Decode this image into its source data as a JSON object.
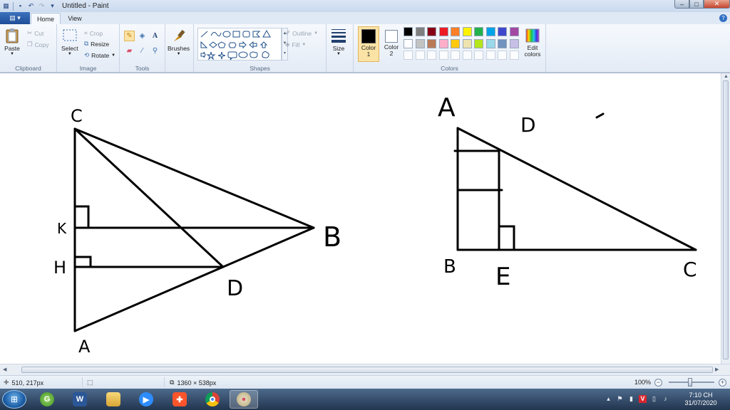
{
  "window": {
    "title": "Untitled - Paint",
    "minimize_glyph": "–",
    "maximize_glyph": "□",
    "close_glyph": "✕"
  },
  "tabs": {
    "home": "Home",
    "view": "View"
  },
  "help_glyph": "?",
  "clipboard": {
    "paste": "Paste",
    "cut": "Cut",
    "copy": "Copy",
    "label": "Clipboard"
  },
  "image_group": {
    "select": "Select",
    "crop": "Crop",
    "resize": "Resize",
    "rotate": "Rotate",
    "label": "Image"
  },
  "tools": {
    "label": "Tools"
  },
  "brushes": {
    "label": "Brushes"
  },
  "shapes": {
    "outline": "Outline",
    "fill": "Fill",
    "label": "Shapes"
  },
  "size": {
    "label": "Size"
  },
  "colors_group": {
    "color1": "Color 1",
    "color2": "Color 2",
    "edit_colors": "Edit colors",
    "label": "Colors",
    "color1_value": "#000000",
    "color2_value": "#ffffff",
    "palette": [
      "#000000",
      "#7f7f7f",
      "#880015",
      "#ed1c24",
      "#ff7f27",
      "#fff200",
      "#22b14c",
      "#00a2e8",
      "#3f48cc",
      "#a349a4",
      "#ffffff",
      "#c3c3c3",
      "#b97a57",
      "#ffaec9",
      "#ffc90e",
      "#efe4b0",
      "#b5e61d",
      "#99d9ea",
      "#7092be",
      "#c8bfe7"
    ]
  },
  "canvas": {
    "labels": {
      "left_C": "C",
      "left_K": "K",
      "left_H": "H",
      "left_B": "B",
      "left_D": "D",
      "left_A": "A",
      "right_A": "A",
      "right_D": "D",
      "right_B": "B",
      "right_E": "E",
      "right_C": "C"
    }
  },
  "status": {
    "cursor_position": "510, 217px",
    "image_size": "1360 × 538px",
    "zoom": "100%"
  },
  "taskbar": {
    "apps": [
      "start-orb",
      "greenshot",
      "word",
      "file-explorer",
      "zoom",
      "brave",
      "chrome",
      "paint"
    ],
    "clock_time": "7:10 CH",
    "clock_date": "31/07/2020"
  }
}
